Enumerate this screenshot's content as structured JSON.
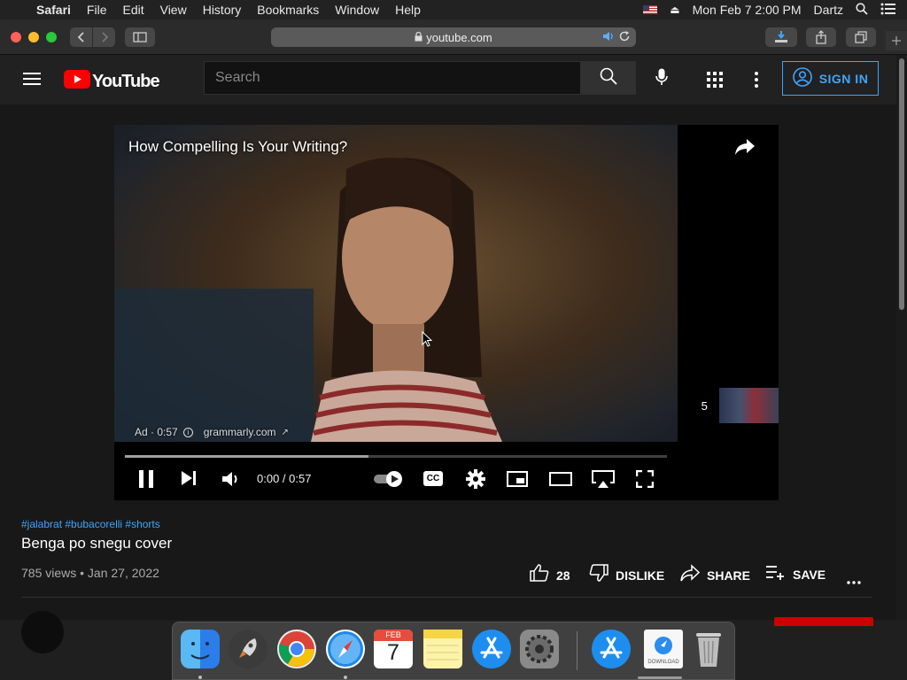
{
  "menubar": {
    "app": "Safari",
    "items": [
      "File",
      "Edit",
      "View",
      "History",
      "Bookmarks",
      "Window",
      "Help"
    ],
    "datetime": "Mon Feb 7  2:00 PM",
    "user": "Dartz"
  },
  "browser": {
    "url": "youtube.com"
  },
  "youtube": {
    "logo_text": "YouTube",
    "search_placeholder": "Search",
    "sign_in": "SIGN IN"
  },
  "player": {
    "ad_title": "How Compelling Is Your Writing?",
    "ad_label": "Ad · 0:57",
    "ad_domain": "grammarly.com",
    "time": "0:00 / 0:57",
    "skip_countdown": "5",
    "progress_fraction": 0.45,
    "cc_label": "CC"
  },
  "video": {
    "hashtags": "#jalabrat #bubacorelli #shorts",
    "title": "Benga po snegu cover",
    "meta": "785 views • Jan 27, 2022",
    "likes": "28",
    "dislike": "DISLIKE",
    "share": "SHARE",
    "save": "SAVE"
  },
  "dock": {
    "calendar_month": "FEB",
    "calendar_day": "7",
    "download_label": "DOWNLOAD"
  },
  "colors": {
    "accent": "#3ea6ff",
    "youtube_red": "#ff0000",
    "background": "#181818"
  }
}
